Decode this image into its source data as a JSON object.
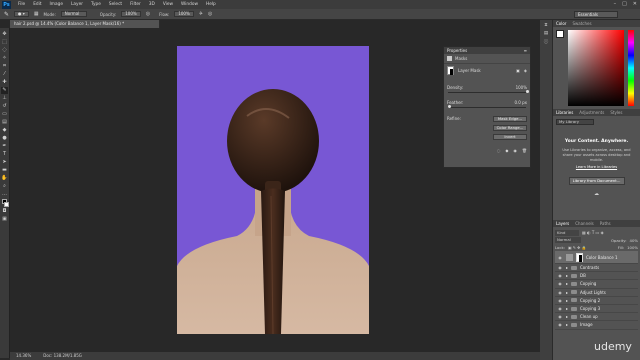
{
  "menu": [
    "File",
    "Edit",
    "Image",
    "Layer",
    "Type",
    "Select",
    "Filter",
    "3D",
    "View",
    "Window",
    "Help"
  ],
  "options": {
    "mode_label": "Mode:",
    "mode_value": "Normal",
    "opacity_label": "Opacity:",
    "opacity_value": "100%",
    "flow_label": "Flow:",
    "flow_value": "100%",
    "workspace": "Essentials"
  },
  "document": {
    "tab_title": "hair 2.psd @ 14.4% (Color Balance 1, Layer Mask/16) *",
    "zoom": "14.36%",
    "doc_size": "Doc: 138.2M/1.85G"
  },
  "properties": {
    "title": "Properties",
    "section": "Masks",
    "mask_type": "Layer Mask",
    "density_label": "Density:",
    "density_value": "100%",
    "feather_label": "Feather:",
    "feather_value": "0.0 px",
    "refine_label": "Refine:",
    "mask_edge_button": "Mask Edge...",
    "color_range_button": "Color Range...",
    "invert_button": "Invert"
  },
  "color_panel": {
    "tabs": [
      "Color",
      "Swatches"
    ],
    "hue_color": "#ff0000"
  },
  "libraries": {
    "tabs": [
      "Libraries",
      "Adjustments",
      "Styles"
    ],
    "dropdown": "My Library",
    "headline": "Your Content. Anywhere.",
    "body": "Use Libraries to organize, access, and share your assets across desktop and mobile.",
    "link": "Learn More in Libraries",
    "button": "Library from Document..."
  },
  "layers": {
    "tabs": [
      "Layers",
      "Channels",
      "Paths"
    ],
    "kind_label": "Kind",
    "blend_mode": "Normal",
    "opacity_label": "Opacity:",
    "opacity_value": "40%",
    "lock_label": "Lock:",
    "fill_label": "Fill:",
    "fill_value": "100%",
    "items": [
      {
        "name": "Color Balance 1",
        "type": "adjustment"
      },
      {
        "name": "Contrasts",
        "type": "folder"
      },
      {
        "name": "DB",
        "type": "folder"
      },
      {
        "name": "Copying",
        "type": "folder"
      },
      {
        "name": "Adjust Lights",
        "type": "folder"
      },
      {
        "name": "Copying 2",
        "type": "folder"
      },
      {
        "name": "Copying 3",
        "type": "folder"
      },
      {
        "name": "Clean up",
        "type": "folder"
      },
      {
        "name": "Image",
        "type": "layer"
      }
    ]
  },
  "watermark": "udemy"
}
